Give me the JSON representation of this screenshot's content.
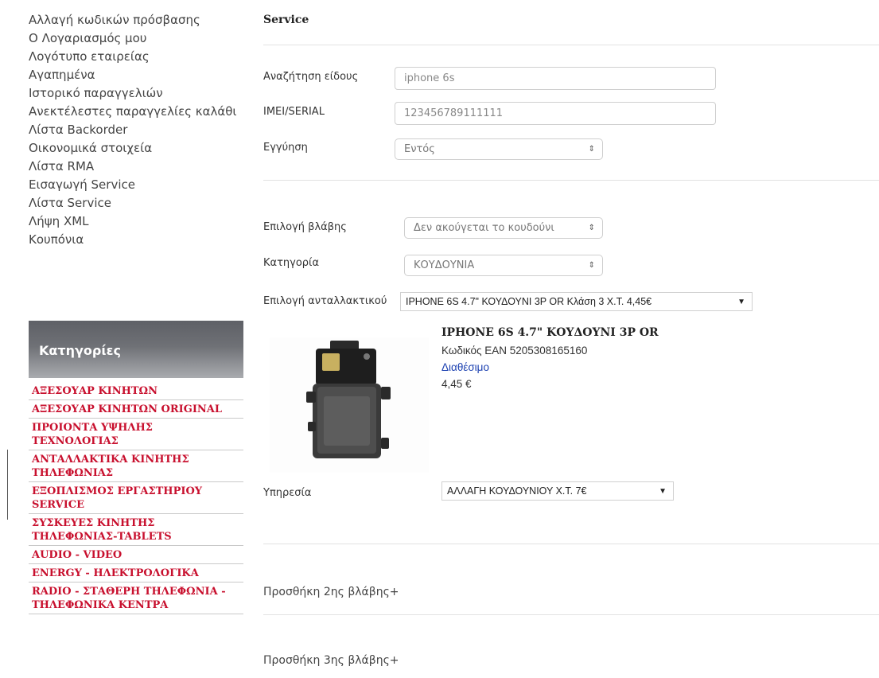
{
  "account_menu": [
    "Αλλαγή κωδικών πρόσβασης",
    "Ο Λογαριασμός μου",
    "Λογότυπο εταιρείας",
    "Αγαπημένα",
    "Ιστορικό παραγγελιών",
    "Ανεκτέλεστες παραγγελίες καλάθι",
    "Λίστα Backorder",
    "Οικονομικά στοιχεία",
    "Λίστα RMA",
    "Εισαγωγή Service",
    "Λίστα Service",
    "Λήψη XML",
    "Κουπόνια"
  ],
  "categories": {
    "header": "Κατηγορίες",
    "items": [
      "ΑΞΕΣΟΥΑΡ ΚΙΝΗΤΩΝ",
      "ΑΞΕΣΟΥΑΡ ΚΙΝΗΤΩΝ ORIGINAL",
      "ΠΡΟΙΟΝΤΑ ΥΨΗΛΗΣ ΤΕΧΝΟΛΟΓΙΑΣ",
      "ΑΝΤΑΛΛΑΚΤΙΚΑ ΚΙΝΗΤΗΣ ΤΗΛΕΦΩΝΙΑΣ",
      "ΕΞΟΠΛΙΣΜΟΣ ΕΡΓΑΣΤΗΡΙΟΥ SERVICE",
      "ΣΥΣΚΕΥΕΣ ΚΙΝΗΤΗΣ ΤΗΛΕΦΩΝΙΑΣ-TABLETS",
      "AUDIO - VIDEO",
      "ENERGY - ΗΛΕΚΤΡΟΛΟΓΙΚΑ",
      "RADIO - ΣΤΑΘΕΡΗ ΤΗΛΕΦΩΝΙΑ - ΤΗΛΕΦΩΝΙΚΑ ΚΕΝΤΡΑ"
    ]
  },
  "service": {
    "title": "Service",
    "search_label": "Αναζήτηση είδους",
    "search_value": "iphone 6s",
    "imei_label": "IMEI/SERIAL",
    "imei_value": "123456789111111",
    "warranty_label": "Εγγύηση",
    "warranty_value": "Εντός",
    "fault_label": "Επιλογή βλάβης",
    "fault_value": "Δεν ακούγεται το κουδούνι",
    "category_label": "Κατηγορία",
    "category_value": "ΚΟΥΔΟΥΝΙΑ",
    "part_label": "Επιλογή ανταλλακτικού",
    "part_value": "IPHONE 6S 4.7\" ΚΟΥΔΟΥΝΙ 3P OR Κλάση 3 Χ.Τ. 4,45€",
    "product": {
      "name": "IPHONE 6S 4.7\" ΚΟΥΔΟΥΝΙ 3P OR",
      "ean": "Κωδικός EAN 5205308165160",
      "availability": "Διαθέσιμο",
      "price": "4,45 €"
    },
    "service_label": "Υπηρεσία",
    "service_value": "ΑΛΛΑΓΗ ΚΟΥΔΟΥΝΙΟΥ Χ.Τ. 7€",
    "add_fault_2": "Προσθήκη 2ης βλάβης+",
    "add_fault_3": "Προσθήκη 3ης βλάβης+"
  },
  "icons": {
    "select_arrows": "⇕",
    "dropdown_arrow": "▼"
  }
}
